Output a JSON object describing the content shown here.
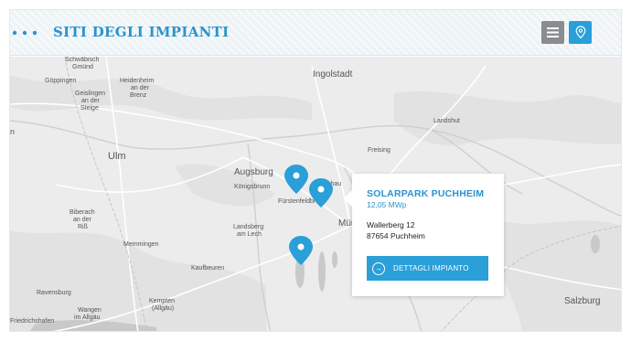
{
  "header": {
    "title": "SITI DEGLI IMPIANTI",
    "list_icon": "list-icon",
    "map_icon": "map-pin-icon"
  },
  "map": {
    "cities_major": {
      "ingolstadt": "Ingolstadt",
      "ulm": "Ulm",
      "augsburg": "Augsburg",
      "munchen": "Mün",
      "salzburg": "Salzburg"
    },
    "cities_minor": {
      "schwabisch_gmund_1": "Schwäbisch",
      "schwabisch_gmund_2": "Gmünd",
      "goppingen": "Göppingen",
      "heidenheim_1": "Heidenheim",
      "heidenheim_2": "an der",
      "heidenheim_3": "Brenz",
      "geislingen_1": "Geislingen",
      "geislingen_2": "an der",
      "geislingen_3": "Steige",
      "landshut": "Landshut",
      "freising": "Freising",
      "konigsbrunn": "Königsbrunn",
      "fuerstenfeldbruck": "Fürstenfeldbruck",
      "dachau": "chau",
      "biberach_1": "Biberach",
      "biberach_2": "an der",
      "biberach_3": "Riß",
      "landsberg_1": "Landsberg",
      "landsberg_2": "am Lech",
      "memmingen": "Memmingen",
      "kaufbeuren": "Kaufbeuren",
      "ravensburg": "Ravensburg",
      "wangen_1": "Wangen",
      "wangen_2": "im Allgäu",
      "kempten_1": "Kempten",
      "kempten_2": "(Allgäu)",
      "friedrichshafen": "Friedrichshafen",
      "edge_n": "n"
    },
    "marker_color": "#2a9fd8"
  },
  "popup": {
    "name": "SOLARPARK PUCHHEIM",
    "power": "12,05 MWp",
    "street": "Wallerberg 12",
    "city": "87654 Puchheim",
    "button_label": "DETTAGLI IMPIANTO",
    "button_icon": "arrow-right-circle-icon"
  },
  "colors": {
    "accent": "#2a9fd8",
    "title": "#2a93cf",
    "list_button": "#8a8d8f"
  }
}
